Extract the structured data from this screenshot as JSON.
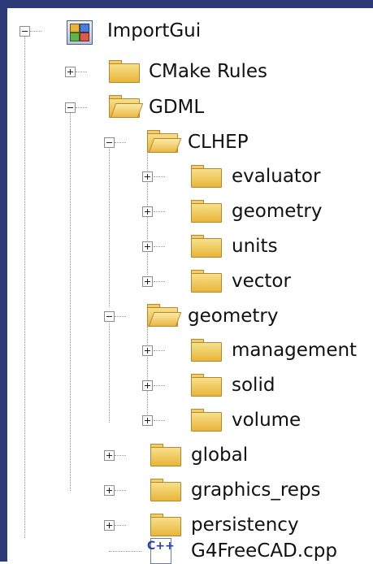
{
  "tree": {
    "root": {
      "label": "ImportGui",
      "icon": "project-icon",
      "expanded": true
    },
    "items": [
      {
        "label": "CMake Rules",
        "icon": "folder-closed-icon",
        "expanded": false
      },
      {
        "label": "GDML",
        "icon": "folder-open-icon",
        "expanded": true
      },
      {
        "label": "CLHEP",
        "icon": "folder-open-icon",
        "expanded": true
      },
      {
        "label": "evaluator",
        "icon": "folder-closed-icon",
        "expanded": false
      },
      {
        "label": "geometry",
        "icon": "folder-closed-icon",
        "expanded": false
      },
      {
        "label": "units",
        "icon": "folder-closed-icon",
        "expanded": false
      },
      {
        "label": "vector",
        "icon": "folder-closed-icon",
        "expanded": false
      },
      {
        "label": "geometry",
        "icon": "folder-open-icon",
        "expanded": true
      },
      {
        "label": "management",
        "icon": "folder-closed-icon",
        "expanded": false
      },
      {
        "label": "solid",
        "icon": "folder-closed-icon",
        "expanded": false
      },
      {
        "label": "volume",
        "icon": "folder-closed-icon",
        "expanded": false
      },
      {
        "label": "global",
        "icon": "folder-closed-icon",
        "expanded": false
      },
      {
        "label": "graphics_reps",
        "icon": "folder-closed-icon",
        "expanded": false
      },
      {
        "label": "persistency",
        "icon": "folder-closed-icon",
        "expanded": false
      },
      {
        "label": "G4FreeCAD.cpp",
        "icon": "cpp-file-icon"
      }
    ],
    "cpp_badge": "C++"
  },
  "colors": {
    "frame": "#2c3a7a",
    "background": "#ffffff",
    "text": "#111111"
  }
}
